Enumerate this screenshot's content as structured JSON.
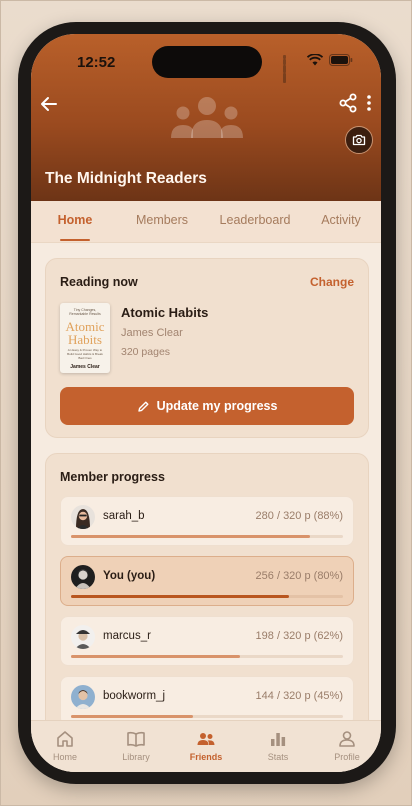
{
  "status_bar": {
    "time": "12:52"
  },
  "group": {
    "name": "The Midnight Readers"
  },
  "tabs": [
    {
      "label": "Home",
      "active": true
    },
    {
      "label": "Members",
      "active": false
    },
    {
      "label": "Leaderboard",
      "active": false
    },
    {
      "label": "Activity",
      "active": false
    }
  ],
  "reading_now": {
    "title": "Reading now",
    "change_label": "Change",
    "book": {
      "title": "Atomic Habits",
      "author": "James Clear",
      "pages": "320 pages",
      "cover_tagline": "Tiny Changes, Remarkable Results",
      "cover_title_line1": "Atomic",
      "cover_title_line2": "Habits",
      "cover_subtitle": "An Easy & Proven Way to Build Good Habits & Break Bad Ones",
      "cover_author": "James Clear"
    },
    "update_button_label": "Update my progress"
  },
  "member_progress": {
    "title": "Member progress",
    "members": [
      {
        "name": "sarah_b",
        "stats": "280 / 320 p  (88%)",
        "progress": 0.88,
        "highlight": false
      },
      {
        "name": "You (you)",
        "stats": "256 / 320 p  (80%)",
        "progress": 0.8,
        "highlight": true
      },
      {
        "name": "marcus_r",
        "stats": "198 / 320 p  (62%)",
        "progress": 0.62,
        "highlight": false
      },
      {
        "name": "bookworm_j",
        "stats": "144 / 320 p  (45%)",
        "progress": 0.45,
        "highlight": false
      }
    ]
  },
  "bottom_nav": [
    {
      "label": "Home",
      "icon": "home-icon",
      "active": false
    },
    {
      "label": "Library",
      "icon": "book-icon",
      "active": false
    },
    {
      "label": "Friends",
      "icon": "people-icon",
      "active": true
    },
    {
      "label": "Stats",
      "icon": "bar-chart-icon",
      "active": false
    },
    {
      "label": "Profile",
      "icon": "person-icon",
      "active": false
    }
  ],
  "colors": {
    "accent": "#c4612e",
    "header": "#9a4a1f",
    "background": "#f6ebe0"
  }
}
